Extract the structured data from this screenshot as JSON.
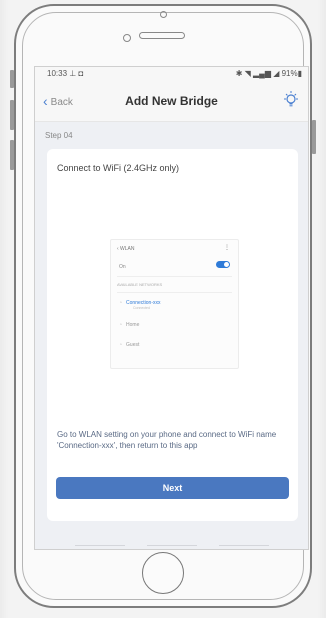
{
  "status": {
    "time": "10:33",
    "notif_icons": "⊥ ◘",
    "right": "✱ ◥ ▂▄▆ ◢ 91%▮"
  },
  "nav": {
    "back_label": "Back",
    "title": "Add New Bridge",
    "bulb_icon": "lightbulb-icon"
  },
  "step_label": "Step 04",
  "card": {
    "heading": "Connect to WiFi (2.4GHz only)",
    "description": "Go to WLAN setting on your phone and connect to WiFi name 'Connection-xxx', then return to this app",
    "next_label": "Next"
  },
  "mini_screen": {
    "header": "‹   WLAN",
    "dots": "⋮",
    "on_label": "On",
    "section": "AVAILABLE NETWORKS",
    "networks": [
      {
        "name": "Connection-xxx",
        "sub": "Connected"
      },
      {
        "name": "Home",
        "sub": ""
      },
      {
        "name": "Guest",
        "sub": ""
      }
    ]
  },
  "colors": {
    "accent": "#4a78c0",
    "toggle": "#2f7bd8"
  }
}
